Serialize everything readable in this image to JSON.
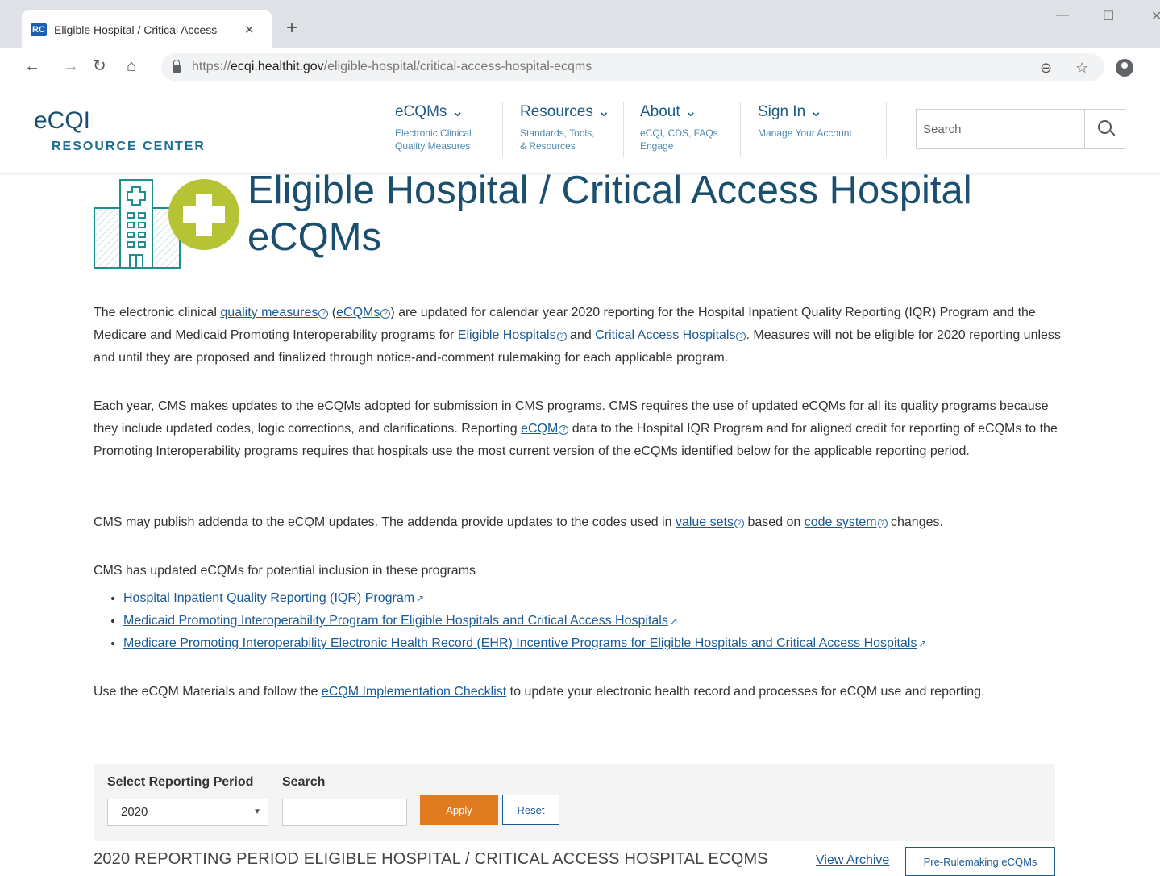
{
  "browser": {
    "tab_favicon": "RC",
    "tab_title": "Eligible Hospital / Critical Access",
    "tab_close": "✕",
    "new_tab": "+",
    "url_scheme": "https://",
    "url_domain": "ecqi.healthit.gov",
    "url_path": "/eligible-hospital/critical-access-hospital-ecqms"
  },
  "site": {
    "logo_main": "eCQI",
    "logo_sub": "RESOURCE CENTER",
    "nav": [
      {
        "title": "eCQMs ⌄",
        "sub": "Electronic Clinical\nQuality Measures"
      },
      {
        "title": "Resources ⌄",
        "sub": "Standards, Tools,\n& Resources"
      },
      {
        "title": "About ⌄",
        "sub": "eCQI, CDS, FAQs\nEngage"
      },
      {
        "title": "Sign In ⌄",
        "sub": "Manage Your Account"
      }
    ],
    "search_placeholder": "Search"
  },
  "page": {
    "title": "Eligible Hospital / Critical Access Hospital eCQMs",
    "p1": {
      "t1": "The electronic clinical ",
      "l1": "quality measures",
      "t2": " (",
      "l2": "eCQMs",
      "t3": ") are updated for calendar year 2020 reporting for the Hospital Inpatient Quality Reporting (IQR) Program and the Medicare and Medicaid Promoting Interoperability programs for ",
      "l3": "Eligible Hospitals",
      "t4": " and ",
      "l4": "Critical Access Hospitals",
      "t5": ". Measures will not be eligible for 2020 reporting unless and until they are proposed and finalized through notice-and-comment rulemaking for each applicable program."
    },
    "p2": {
      "t1": "Each year, CMS makes updates to the eCQMs adopted for submission in CMS programs. CMS requires the use of updated eCQMs for all its quality programs because they include updated codes, logic corrections, and clarifications. Reporting ",
      "l1": "eCQM",
      "t2": " data to the Hospital IQR Program and for aligned credit for reporting of eCQMs to the Promoting Interoperability programs requires that hospitals use the most current version of the eCQMs identified below for the applicable reporting period."
    },
    "p3": {
      "t1": "CMS may publish addenda to the eCQM updates.  The addenda provide updates to the codes used in ",
      "l1": "value sets",
      "t2": " based on ",
      "l2": "code system",
      "t3": " changes."
    },
    "p4": "CMS has updated eCQMs for potential inclusion in these programs",
    "programs": [
      "Hospital Inpatient Quality Reporting (IQR) Program",
      "Medicaid Promoting Interoperability Program for Eligible Hospitals and Critical Access Hospitals",
      "Medicare Promoting Interoperability Electronic Health Record (EHR) Incentive Programs for Eligible Hospitals and Critical Access Hospitals"
    ],
    "p5": {
      "t1": "Use the eCQM Materials and follow the ",
      "l1": "eCQM Implementation Checklist",
      "t2": " to update your electronic health record and processes for eCQM use and reporting."
    },
    "help_glyph": "?",
    "ext_glyph": "↗"
  },
  "filter": {
    "period_label": "Select Reporting Period",
    "search_label": "Search",
    "period_value": "2020",
    "search_value": "",
    "apply_label": "Apply",
    "reset_label": "Reset"
  },
  "period_heading": "2020 REPORTING PERIOD ELIGIBLE HOSPITAL / CRITICAL ACCESS HOSPITAL ECQMS",
  "view_archive": "View Archive",
  "prerulemaking_label": "Pre-Rulemaking eCQMs",
  "colors": {
    "brand_navy": "#1b4f6f",
    "brand_blue": "#1d6e95",
    "accent_green": "#b5c334",
    "teal": "#1e8e8f",
    "apply_orange": "#e07b20",
    "link": "#1a5a96"
  }
}
